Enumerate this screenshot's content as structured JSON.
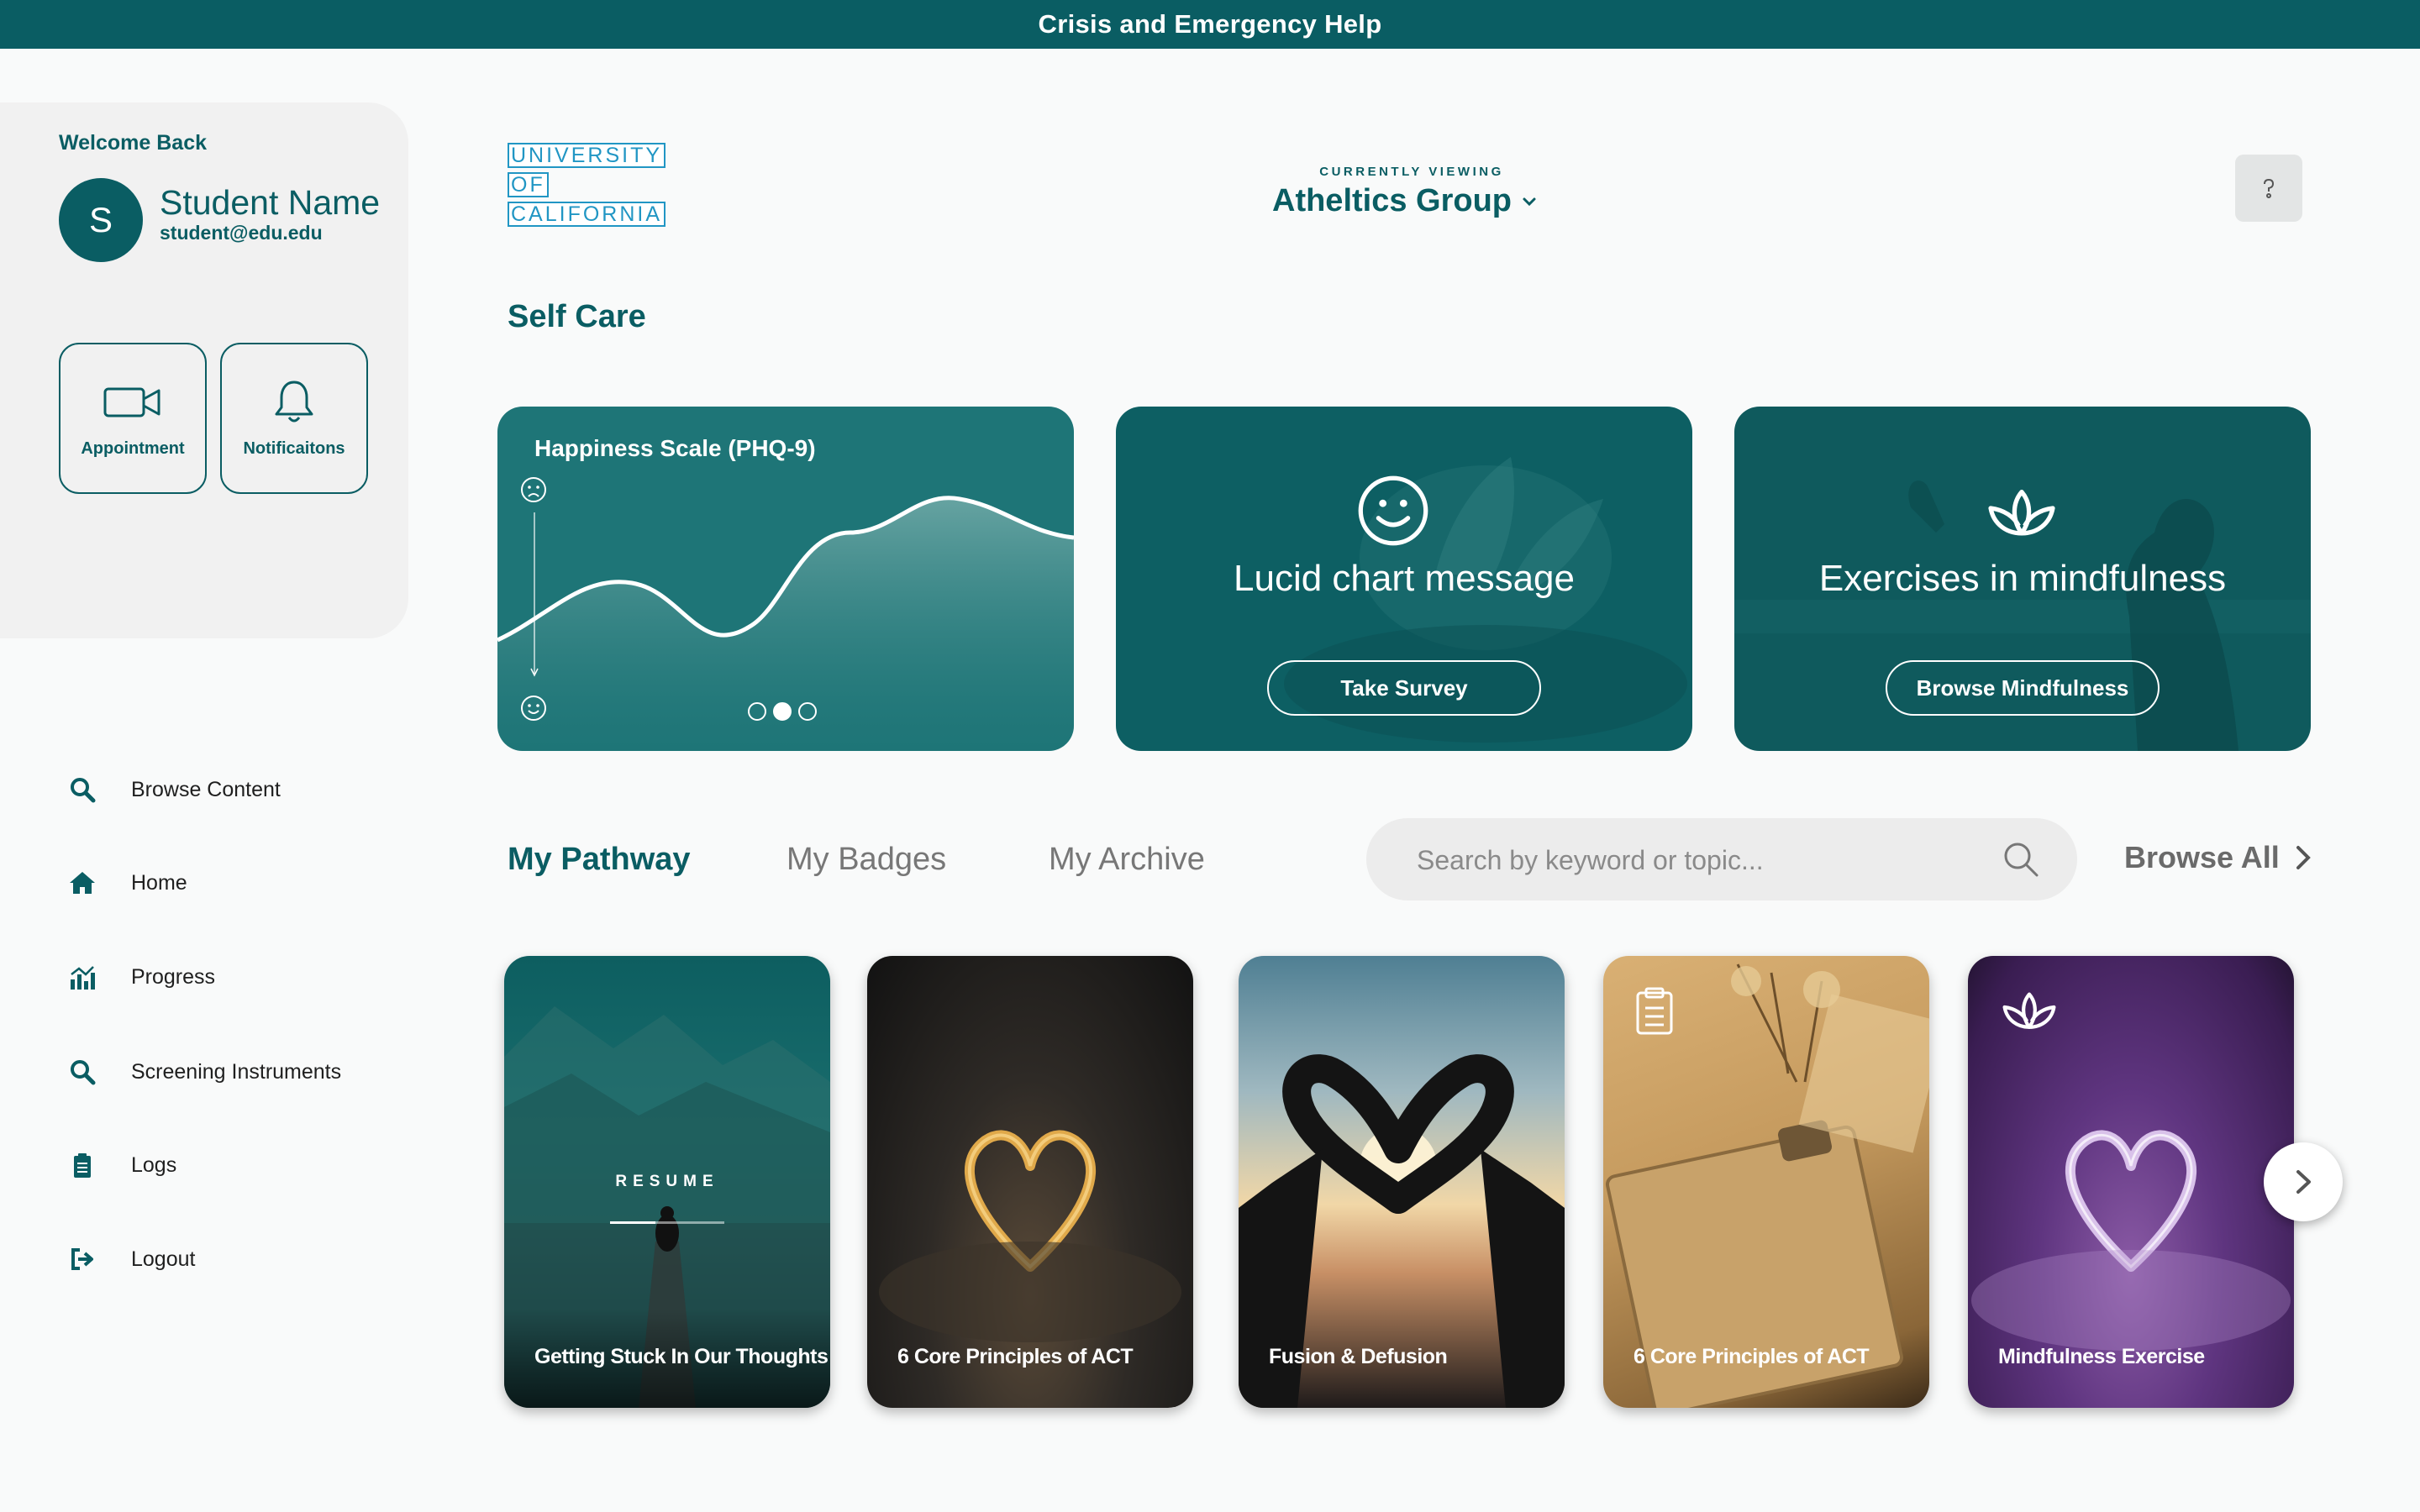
{
  "banner": {
    "text": "Crisis and Emergency Help"
  },
  "profile": {
    "welcome": "Welcome Back",
    "initial": "S",
    "name": "Student Name",
    "email": "student@edu.edu",
    "quick_actions": [
      {
        "label": "Appointment",
        "icon": "video-camera-icon"
      },
      {
        "label": "Notificaitons",
        "icon": "bell-icon"
      }
    ]
  },
  "nav": {
    "items": [
      {
        "label": "Browse Content",
        "icon": "search-icon"
      },
      {
        "label": "Home",
        "icon": "home-icon"
      },
      {
        "label": "Progress",
        "icon": "bar-chart-icon"
      },
      {
        "label": "Screening Instruments",
        "icon": "search-icon"
      },
      {
        "label": "Logs",
        "icon": "clipboard-icon"
      },
      {
        "label": "Logout",
        "icon": "logout-icon"
      }
    ]
  },
  "header": {
    "logo_lines": [
      "UNIVERSITY",
      "OF",
      "CALIFORNIA"
    ],
    "viewing_label": "CURRENTLY VIEWING",
    "group": "Atheltics Group"
  },
  "self_care": {
    "title": "Self Care",
    "cards": [
      {
        "title": "Happiness Scale (PHQ-9)",
        "slide_index": 2,
        "slide_count": 3
      },
      {
        "message": "Lucid chart message",
        "button": "Take Survey"
      },
      {
        "message": "Exercises in mindfulness",
        "button": "Browse Mindfulness"
      }
    ]
  },
  "tabs": {
    "items": [
      "My Pathway",
      "My Badges",
      "My Archive"
    ],
    "active": "My Pathway"
  },
  "search": {
    "placeholder": "Search by keyword or topic..."
  },
  "browse_all": "Browse All",
  "pathway": {
    "resume_label": "RESUME",
    "resume_progress": 0.4,
    "cards": [
      {
        "title": "Getting Stuck In Our Thoughts"
      },
      {
        "title": "6 Core Principles of ACT"
      },
      {
        "title": "Fusion & Defusion"
      },
      {
        "title": "6 Core Principles of ACT",
        "icon": "clipboard-icon"
      },
      {
        "title": "Mindfulness Exercise",
        "icon": "lotus-icon"
      }
    ]
  },
  "colors": {
    "brand": "#0a5d63",
    "logo": "#2196c4"
  }
}
